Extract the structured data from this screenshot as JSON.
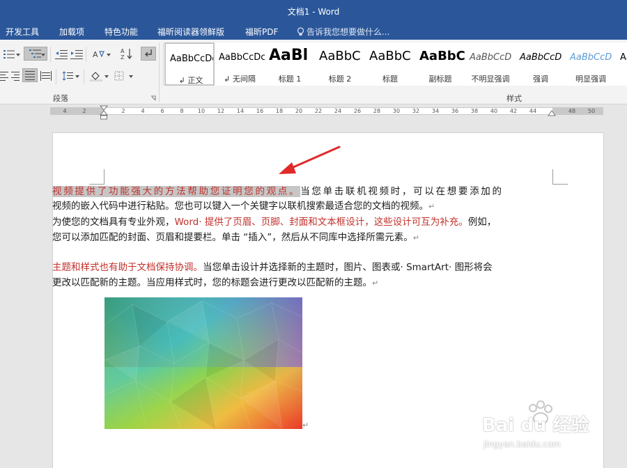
{
  "window": {
    "title": "文档1 - Word"
  },
  "tabs": [
    "开发工具",
    "加载项",
    "特色功能",
    "福昕阅读器领鲜版",
    "福昕PDF"
  ],
  "tell_me": "告诉我您想要做什么...",
  "ribbon": {
    "groups": {
      "paragraph": "段落",
      "styles": "样式"
    },
    "styles": [
      {
        "sample": "AaBbCcDc",
        "name": "↲ 正文"
      },
      {
        "sample": "AaBbCcDc",
        "name": "↲ 无间隔"
      },
      {
        "sample": "AaBl",
        "name": "标题 1"
      },
      {
        "sample": "AaBbC",
        "name": "标题 2"
      },
      {
        "sample": "AaBbC",
        "name": "标题"
      },
      {
        "sample": "AaBbC",
        "name": "副标题"
      },
      {
        "sample": "AaBbCcD",
        "name": "不明显强调"
      },
      {
        "sample": "AaBbCcD",
        "name": "强调"
      },
      {
        "sample": "AaBbCcD",
        "name": "明显强调"
      },
      {
        "sample": "Aa",
        "name": ""
      }
    ]
  },
  "ruler": {
    "numbers": [
      "4",
      "2",
      "2",
      "4",
      "6",
      "8",
      "10",
      "12",
      "14",
      "16",
      "18",
      "20",
      "22",
      "24",
      "26",
      "28",
      "30",
      "32",
      "34",
      "36",
      "38",
      "40",
      "42",
      "44",
      "48",
      "50"
    ]
  },
  "document": {
    "p1": {
      "highlight": "视频提供了功能强大的方法帮助您证明您的观点。",
      "line1_rest": "当您单击联机视频时，可以在想要添加的",
      "line2": "视频的嵌入代码中进行粘贴。您也可以键入一个关键字以联机搜索最适合您的文档的视频。",
      "mark": "↵"
    },
    "p2": {
      "intro": "为使您的文档具有专业外观，",
      "red": "Word· 提供了页眉、页脚、封面和文本框设计，这些设计可互为补充。",
      "rest": "例如，您可以添加匹配的封面、页眉和提要栏。单击 “插入”，然后从不同库中选择所需元素。",
      "mark": "↵"
    },
    "p3": {
      "red": "主题和样式也有助于文档保持协调。",
      "rest": "当您单击设计并选择新的主题时，图片、图表或· SmartArt· 图形将会更改以匹配新的主题。当应用样式时，您的标题会进行更改以匹配新的主题。",
      "mark": "↵"
    },
    "image_mark": "↵"
  },
  "watermark": {
    "logo": "Bai du 经验",
    "url": "jingyan.baidu.com"
  },
  "colors": {
    "titlebar": "#2b579a",
    "red_text": "#c0312b",
    "highlight": "#c6c6c6",
    "arrow": "#e02a2a"
  }
}
